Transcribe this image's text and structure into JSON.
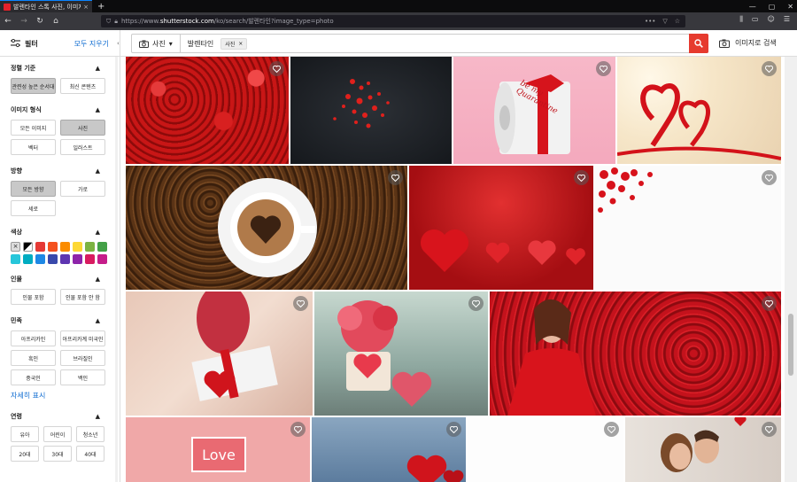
{
  "browser": {
    "tab_title": "발렌타인 스톡 사진, 이미지 및",
    "tab_close": "×",
    "new_tab": "+",
    "url_prefix": "https://www.",
    "url_domain": "shutterstock.com",
    "url_path": "/ko/search/발렌타인?image_type=photo",
    "win_min": "—",
    "win_max": "▢",
    "win_close": "✕",
    "back": "←",
    "forward": "→",
    "reload": "↻",
    "home": "⌂"
  },
  "header": {
    "filter_label": "필터",
    "clear_all": "모두 지우기",
    "search_type": "사진",
    "query": "발렌타인",
    "chip": "사진",
    "chip_x": "×",
    "image_search": "이미지로 검색"
  },
  "sidebar": {
    "sort": {
      "title": "정렬 기준",
      "options": [
        {
          "label": "관련성 높은 순서대",
          "selected": true
        },
        {
          "label": "최신 콘텐츠",
          "selected": false
        }
      ]
    },
    "image_type": {
      "title": "이미지 형식",
      "options": [
        {
          "label": "모든 이미지",
          "selected": false
        },
        {
          "label": "사진",
          "selected": true
        },
        {
          "label": "벡터",
          "selected": false
        },
        {
          "label": "일러스트",
          "selected": false
        }
      ]
    },
    "orientation": {
      "title": "방향",
      "options": [
        {
          "label": "모든 방향",
          "selected": true
        },
        {
          "label": "가로",
          "selected": false
        },
        {
          "label": "세로",
          "selected": false
        }
      ]
    },
    "color": {
      "title": "색상",
      "swatches": [
        "#ffffff",
        "#000000",
        "#e53935",
        "#f4511e",
        "#fb8c00",
        "#fdd835",
        "#7cb342",
        "#43a047",
        "#26c6da",
        "#00acc1",
        "#1e88e5",
        "#3949ab",
        "#5e35b1",
        "#8e24aa",
        "#d81b60",
        "#c51d8a"
      ]
    },
    "people": {
      "title": "인물",
      "options": [
        {
          "label": "인물 포함",
          "selected": false
        },
        {
          "label": "인물 포함 안 함",
          "selected": false
        }
      ]
    },
    "ethnicity": {
      "title": "민족",
      "options": [
        {
          "label": "아프리카인",
          "selected": false
        },
        {
          "label": "아프리카계 미국인",
          "selected": false
        },
        {
          "label": "흑인",
          "selected": false
        },
        {
          "label": "브라질인",
          "selected": false
        },
        {
          "label": "중국인",
          "selected": false
        },
        {
          "label": "백인",
          "selected": false
        }
      ],
      "more": "자세히 표시"
    },
    "age": {
      "title": "연령",
      "options": [
        {
          "label": "유아",
          "selected": false
        },
        {
          "label": "어린이",
          "selected": false
        },
        {
          "label": "청소년",
          "selected": false
        },
        {
          "label": "20대",
          "selected": false
        },
        {
          "label": "30대",
          "selected": false
        },
        {
          "label": "40대",
          "selected": false
        }
      ]
    }
  },
  "images": [
    {
      "name": "red-roses"
    },
    {
      "name": "red-hearts-on-dark"
    },
    {
      "name": "toilet-paper-be-my-quarantine",
      "caption": "be my Quarantine"
    },
    {
      "name": "red-ribbon-hearts"
    },
    {
      "name": "coffee-heart"
    },
    {
      "name": "red-glitter-hearts"
    },
    {
      "name": "red-hearts-on-white"
    },
    {
      "name": "woman-with-gift"
    },
    {
      "name": "flowers-and-hearts"
    },
    {
      "name": "woman-in-petals"
    },
    {
      "name": "love-sign",
      "caption": "Love"
    },
    {
      "name": "blue-background-hearts"
    },
    {
      "name": "white-blank"
    },
    {
      "name": "couple"
    }
  ]
}
